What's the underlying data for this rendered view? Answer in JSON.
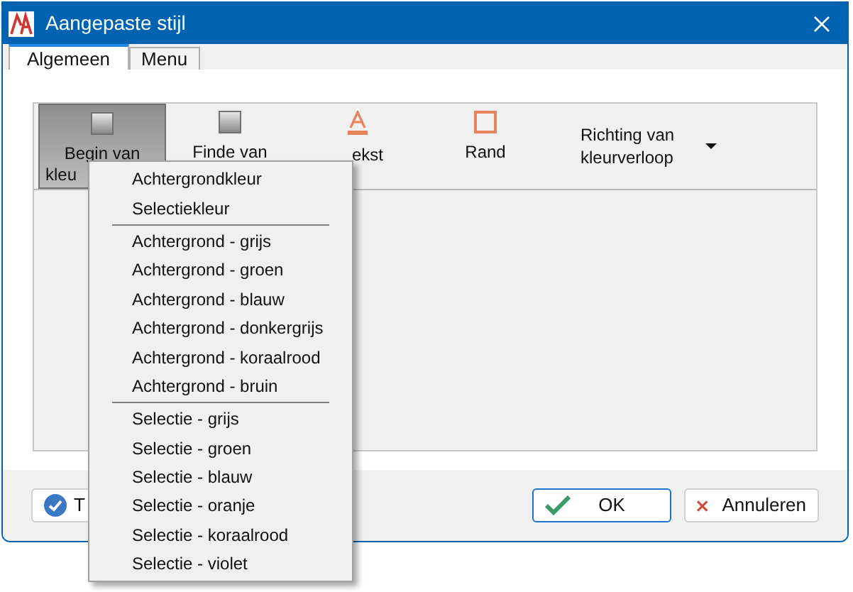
{
  "window": {
    "title": "Aangepaste stijl"
  },
  "tabs": [
    {
      "label": "Algemeen",
      "selected": true
    },
    {
      "label": "Menu",
      "selected": false
    }
  ],
  "toolbar": [
    {
      "kind": "swatch",
      "lines": [
        "Begin van",
        "kleu"
      ],
      "selected": true
    },
    {
      "kind": "swatch",
      "lines": [
        "Finde van"
      ],
      "selected": false
    },
    {
      "kind": "text",
      "lines": [
        "ekst"
      ],
      "selected": false
    },
    {
      "kind": "border",
      "lines": [
        "Rand"
      ],
      "selected": false
    },
    {
      "kind": "dropdown",
      "lines": [
        "Richting van",
        "kleurverloop"
      ],
      "selected": false
    }
  ],
  "menu": {
    "groups": [
      [
        "Achtergrondkleur",
        "Selectiekleur"
      ],
      [
        "Achtergrond - grijs",
        "Achtergrond - groen",
        "Achtergrond - blauw",
        "Achtergrond - donkergrijs",
        "Achtergrond - koraalrood",
        "Achtergrond - bruin"
      ],
      [
        "Selectie - grijs",
        "Selectie - groen",
        "Selectie - blauw",
        "Selectie - oranje",
        "Selectie - koraalrood",
        "Selectie - violet"
      ]
    ]
  },
  "buttons": [
    {
      "kind": "apply",
      "label": "T",
      "default": false
    },
    {
      "kind": "ok",
      "label": "OK",
      "default": true
    },
    {
      "kind": "cancel",
      "label": "Annuleren",
      "default": false
    }
  ]
}
